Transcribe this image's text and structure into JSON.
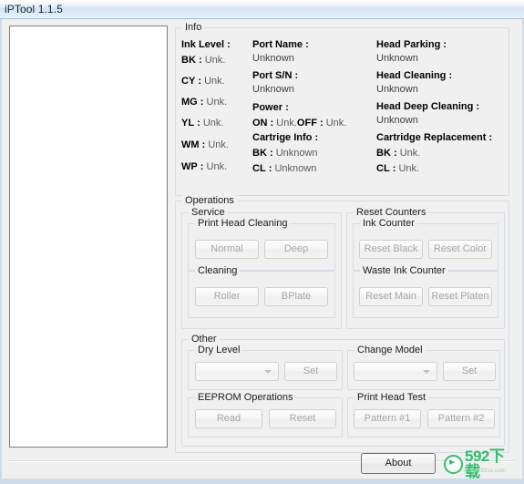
{
  "window": {
    "title": "iPTool 1.1.5"
  },
  "device_list": {
    "items": []
  },
  "info": {
    "legend": "Info",
    "ink_level": {
      "heading": "Ink Level :",
      "rows": [
        {
          "code": "BK",
          "sep": ":",
          "value": "Unk.",
          "color": "#000000"
        },
        {
          "code": "CY",
          "sep": ":",
          "value": "Unk.",
          "color": "#0000d0"
        },
        {
          "code": "MG",
          "sep": ":",
          "value": "Unk.",
          "color": "#e8009a"
        },
        {
          "code": "YL",
          "sep": ":",
          "value": "Unk.",
          "color": "#f2e400"
        },
        {
          "code": "WM",
          "sep": ":",
          "value": "Unk.",
          "color": "#000000"
        },
        {
          "code": "WP",
          "sep": ":",
          "value": "Unk.",
          "color": "#000000"
        }
      ]
    },
    "port_name": {
      "heading": "Port Name :",
      "value": "Unknown"
    },
    "port_sn": {
      "heading": "Port S/N :",
      "value": "Unknown"
    },
    "power": {
      "heading": "Power :",
      "on_label": "ON :",
      "on_value": "Unk.",
      "off_label": "OFF :",
      "off_value": "Unk."
    },
    "cartridge_info": {
      "heading": "Cartrige Info :",
      "rows": [
        {
          "code": "BK",
          "sep": ":",
          "value": "Unknown"
        },
        {
          "code": "CL",
          "sep": ":",
          "value": "Unknown"
        }
      ]
    },
    "head_parking": {
      "heading": "Head Parking :",
      "value": "Unknown"
    },
    "head_cleaning": {
      "heading": "Head Cleaning :",
      "value": "Unknown"
    },
    "head_deep_cleaning": {
      "heading": "Head Deep Cleaning :",
      "value": "Unknown"
    },
    "cartridge_replacement": {
      "heading": "Cartridge Replacement :",
      "rows": [
        {
          "code": "BK",
          "sep": ":",
          "value": "Unk."
        },
        {
          "code": "CL",
          "sep": ":",
          "value": "Unk."
        }
      ]
    }
  },
  "operations": {
    "legend": "Operations",
    "service": {
      "legend": "Service",
      "print_head_cleaning": {
        "legend": "Print Head Cleaning",
        "normal_button": "Normal",
        "deep_button": "Deep"
      },
      "cleaning": {
        "legend": "Cleaning",
        "roller_button": "Roller",
        "bplate_button": "BPlate"
      }
    },
    "reset_counters": {
      "legend": "Reset Counters",
      "ink_counter": {
        "legend": "Ink Counter",
        "reset_black_button": "Reset Black",
        "reset_color_button": "Reset Color"
      },
      "waste_ink_counter": {
        "legend": "Waste Ink Counter",
        "reset_main_button": "Reset Main",
        "reset_platen_button": "Reset Platen"
      }
    },
    "other": {
      "legend": "Other",
      "dry_level": {
        "legend": "Dry Level",
        "selected": "",
        "set_button": "Set"
      },
      "change_model": {
        "legend": "Change Model",
        "selected": "",
        "set_button": "Set"
      },
      "eeprom_operations": {
        "legend": "EEPROM Operations",
        "read_button": "Read",
        "reset_button": "Reset"
      },
      "print_head_test": {
        "legend": "Print Head Test",
        "pattern1_button": "Pattern #1",
        "pattern2_button": "Pattern #2"
      }
    }
  },
  "footer": {
    "about_button": "About",
    "watermark": {
      "text": "592下载",
      "url": "www.592xz.com"
    }
  }
}
